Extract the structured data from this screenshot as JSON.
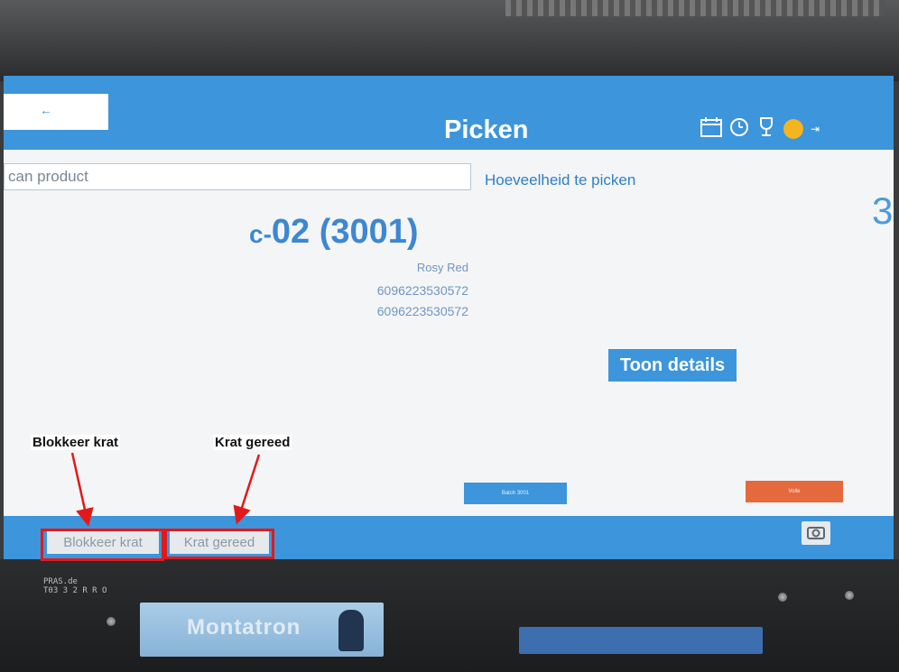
{
  "screen": {
    "header": {
      "back_arrow": "←",
      "title": "Picken",
      "icons": [
        "calendar-icon",
        "clock-icon",
        "trophy-icon",
        "avatar",
        "logout-icon"
      ],
      "accent_color": "#3d95db"
    },
    "scan": {
      "placeholder": "can product"
    },
    "quantity": {
      "label": "Hoeveelheid te picken",
      "value": "3"
    },
    "location": {
      "prefix": "c-",
      "code": "02 (3001)"
    },
    "product": {
      "name": "Rosy Red",
      "barcodes": [
        "6096223530572",
        "6096223530572"
      ]
    },
    "buttons": {
      "details": "Toon details",
      "mid": "Batch 3001",
      "right": "Volle",
      "block": "Blokkeer krat",
      "done": "Krat gereed"
    },
    "footer": {
      "camera_icon": "camera-icon"
    }
  },
  "annotations": {
    "block_label": "Blokkeer krat",
    "done_label": "Krat gereed",
    "color": "#e2191b"
  },
  "hardware": {
    "monitor_label": [
      "PRAS.de",
      "T03 3 2 R R O"
    ],
    "brand": "Montatron"
  }
}
